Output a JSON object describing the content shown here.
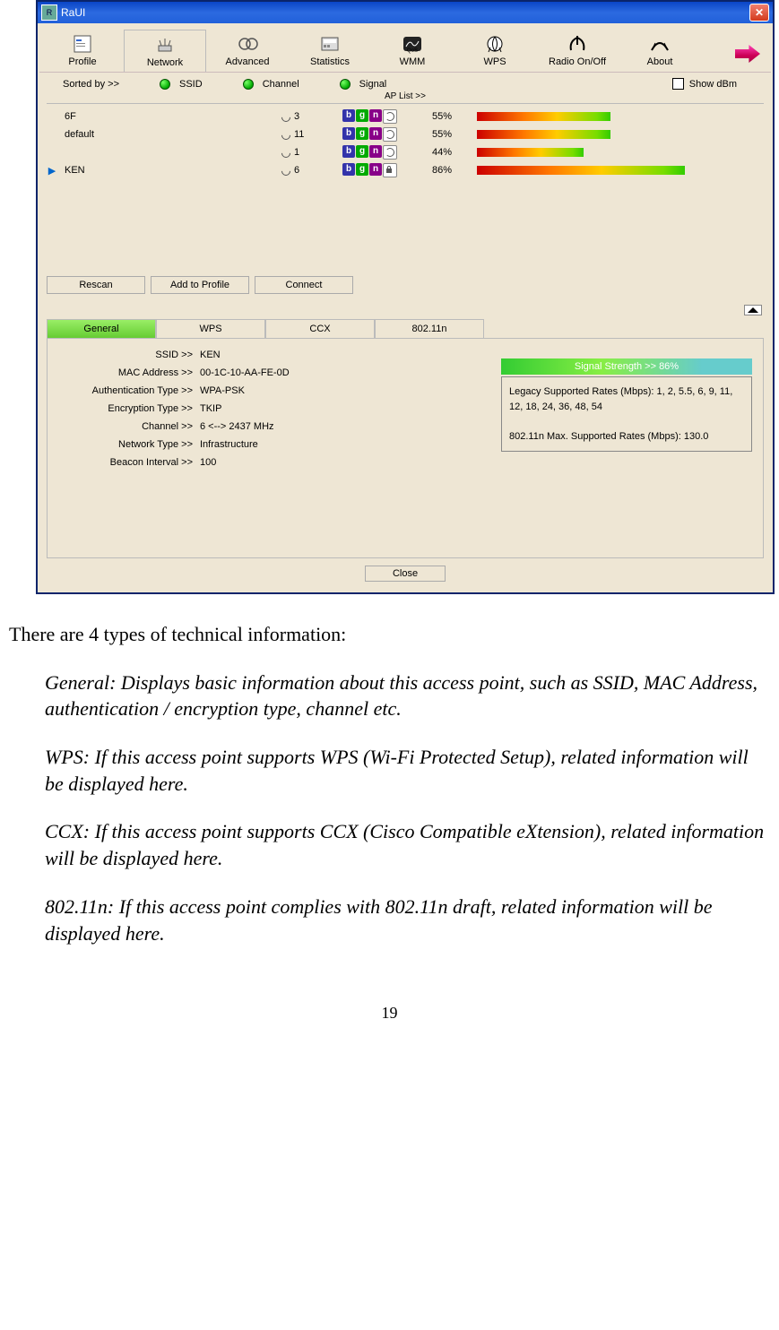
{
  "window": {
    "title": "RaUI"
  },
  "toolbar": [
    "Profile",
    "Network",
    "Advanced",
    "Statistics",
    "WMM",
    "WPS",
    "Radio On/Off",
    "About"
  ],
  "active_tool": 1,
  "sort": {
    "label": "Sorted by >>",
    "ssid": "SSID",
    "channel": "Channel",
    "signal": "Signal",
    "show_dbm": "Show dBm"
  },
  "aplist_label": "AP List >>",
  "aps": [
    {
      "mark": "",
      "ssid": "6F",
      "ch": "3",
      "icons": [
        "b",
        "g",
        "n",
        "r"
      ],
      "pct": "55%",
      "bar": 55
    },
    {
      "mark": "",
      "ssid": "default",
      "ch": "11",
      "icons": [
        "b",
        "g",
        "n",
        "r"
      ],
      "pct": "55%",
      "bar": 55
    },
    {
      "mark": "",
      "ssid": "",
      "ch": "1",
      "icons": [
        "b",
        "g",
        "n",
        "r"
      ],
      "pct": "44%",
      "bar": 44
    },
    {
      "mark": "▶",
      "ssid": "KEN",
      "ch": "6",
      "icons": [
        "b",
        "g",
        "n",
        "l"
      ],
      "pct": "86%",
      "bar": 86
    }
  ],
  "buttons": {
    "rescan": "Rescan",
    "add": "Add to Profile",
    "connect": "Connect"
  },
  "dtabs": [
    "General",
    "WPS",
    "CCX",
    "802.11n"
  ],
  "active_dtab": 0,
  "fields": [
    {
      "l": "SSID >>",
      "v": "KEN"
    },
    {
      "l": "MAC Address >>",
      "v": "00-1C-10-AA-FE-0D"
    },
    {
      "l": "Authentication Type >>",
      "v": "WPA-PSK"
    },
    {
      "l": "Encryption Type >>",
      "v": "TKIP"
    },
    {
      "l": "Channel >>",
      "v": "6 <--> 2437 MHz"
    },
    {
      "l": "Network Type >>",
      "v": "Infrastructure"
    },
    {
      "l": "Beacon Interval >>",
      "v": "100"
    }
  ],
  "signal_label": "Signal Strength >> 86%",
  "rates1": "Legacy Supported Rates (Mbps): 1, 2, 5.5, 6, 9, 11, 12, 18, 24, 36, 48, 54",
  "rates2": "802.11n Max. Supported Rates (Mbps): 130.0",
  "close": "Close",
  "doc": {
    "intro": "There are 4 types of technical information:",
    "general": "General: Displays basic information about this access point, such as SSID, MAC Address, authentication / encryption type, channel etc.",
    "wps": "WPS: If this access point supports WPS (Wi-Fi Protected Setup), related information will be displayed here.",
    "ccx": "CCX: If this access point supports CCX (Cisco Compatible eXtension), related information will be displayed here.",
    "n": "802.11n: If this access point complies with 802.11n draft, related information will be displayed here."
  },
  "pagenum": "19"
}
